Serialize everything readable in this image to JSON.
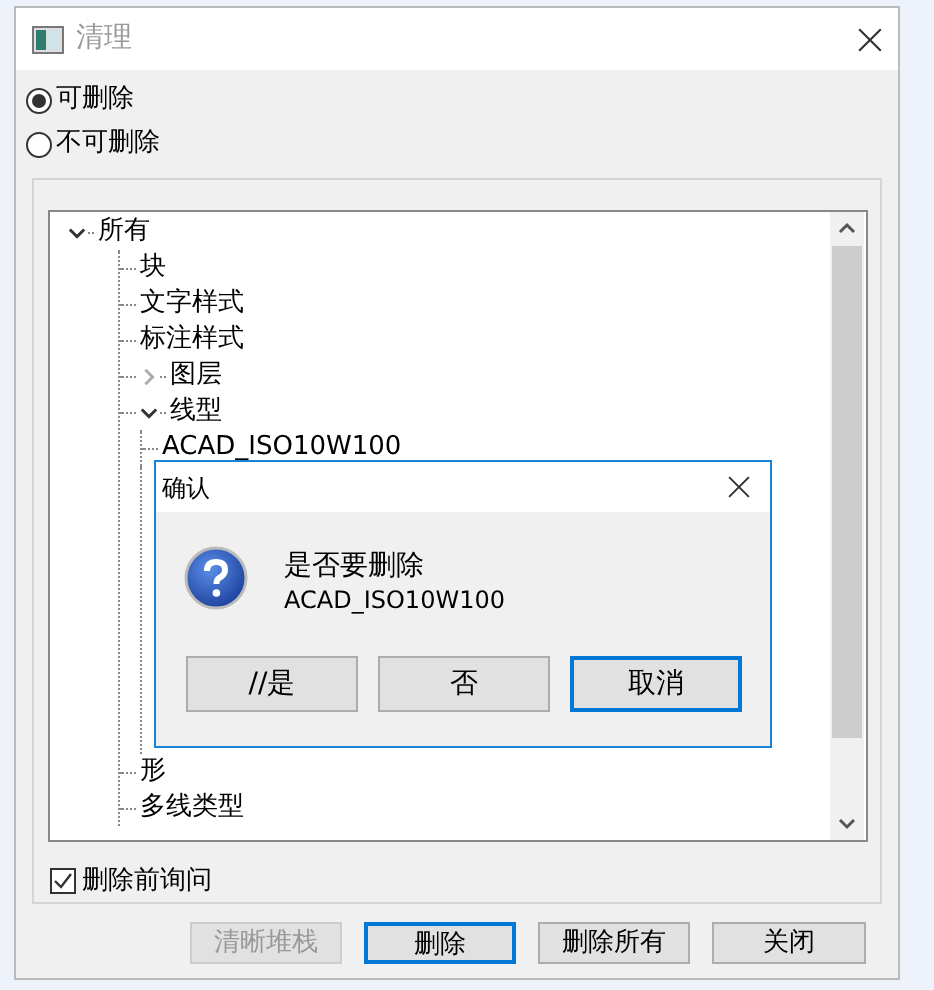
{
  "window": {
    "title": "清理"
  },
  "radios": [
    {
      "label": "可删除",
      "selected": true
    },
    {
      "label": "不可删除",
      "selected": false
    }
  ],
  "tree": {
    "label": "所有",
    "expanded": true,
    "children": [
      {
        "label": "块"
      },
      {
        "label": "文字样式"
      },
      {
        "label": "标注样式"
      },
      {
        "label": "图层",
        "expanded": false
      },
      {
        "label": "线型",
        "expanded": true,
        "children": [
          {
            "label": "ACAD_ISO10W100"
          }
        ]
      },
      {
        "label": "形"
      },
      {
        "label": "多线类型"
      }
    ]
  },
  "confirm_checkbox": {
    "label": "删除前询问",
    "checked": true
  },
  "buttons": [
    {
      "label": "清晰堆栈",
      "disabled": true,
      "default": false
    },
    {
      "label": "删除",
      "disabled": false,
      "default": true
    },
    {
      "label": "删除所有",
      "disabled": false,
      "default": false
    },
    {
      "label": "关闭",
      "disabled": false,
      "default": false
    }
  ],
  "confirm_dialog": {
    "title": "确认",
    "message": "是否要删除",
    "item": "ACAD_ISO10W100",
    "buttons": [
      {
        "label": "//是",
        "focused": false
      },
      {
        "label": "否",
        "focused": false
      },
      {
        "label": "取消",
        "focused": true
      }
    ]
  }
}
